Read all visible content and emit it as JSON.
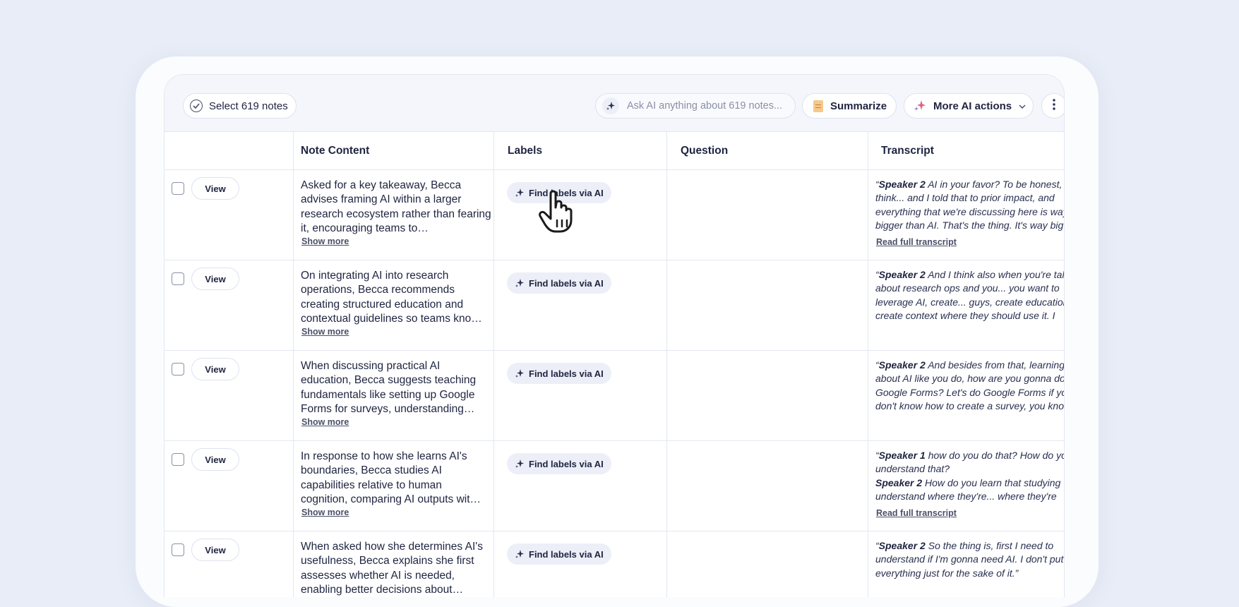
{
  "toolbar": {
    "select_label": "Select 619 notes",
    "ask_placeholder": "Ask AI anything about 619 notes...",
    "summarize_label": "Summarize",
    "more_ai_label": "More AI actions"
  },
  "columns": {
    "note_content": "Note Content",
    "labels": "Labels",
    "question": "Question",
    "transcript": "Transcript"
  },
  "rows": [
    {
      "view": "View",
      "note": "Asked for a key takeaway, Becca advises framing AI within a larger research ecosystem rather than fearing it, encouraging teams to…",
      "show_more": "Show more",
      "label_action": "Find labels via AI",
      "t_open": "“",
      "t1_speaker": "Speaker 2",
      "t1_text": " AI in your favor? To be honest, I",
      "t2": "think... and I told that to prior impact, and",
      "t3": "everything that we're discussing here is way",
      "t4": "bigger than AI. That's the thing. It's way big",
      "read_full": "Read full transcript"
    },
    {
      "view": "View",
      "note": "On integrating AI into research operations, Becca recommends creating structured education and contextual guidelines so teams kno…",
      "show_more": "Show more",
      "label_action": "Find labels via AI",
      "t_open": "“",
      "t1_speaker": "Speaker 2",
      "t1_text": " And I think also when you're talking",
      "t2": "about research ops and you... you want to",
      "t3": "leverage AI, create... guys, create education,",
      "t4": "create context where they should use it. I"
    },
    {
      "view": "View",
      "note": "When discussing practical AI education, Becca suggests teaching fundamentals like setting up Google Forms for surveys, understanding…",
      "show_more": "Show more",
      "label_action": "Find labels via AI",
      "t_open": "“",
      "t1_speaker": "Speaker 2",
      "t1_text": " And besides from that, learning",
      "t2": "about AI like you do, how are you gonna do",
      "t3": "Google Forms? Let's do Google Forms if you",
      "t4": "don't know how to create a survey, you know"
    },
    {
      "view": "View",
      "note": "In response to how she learns AI's boundaries, Becca studies AI capabilities relative to human cognition, comparing AI outputs wit…",
      "show_more": "Show more",
      "label_action": "Find labels via AI",
      "t_open": "“",
      "t1_speaker": "Speaker 1",
      "t1_text": " how do you do that? How do you",
      "t2": "understand that?",
      "t3_speaker": "Speaker 2",
      "t3_text": " How do you learn that studying",
      "t4": "understand where they're... where they're",
      "read_full": "Read full transcript"
    },
    {
      "view": "View",
      "note": "When asked how she determines AI's usefulness, Becca explains she first assesses whether AI is needed, enabling better decisions about…",
      "label_action": "Find labels via AI",
      "t_open": "“",
      "t1_speaker": "Speaker 2",
      "t1_text": " So the thing is, first I need to",
      "t2": "understand if I'm gonna need AI. I don't put",
      "t3": "everything just for the sake of it.”"
    }
  ]
}
